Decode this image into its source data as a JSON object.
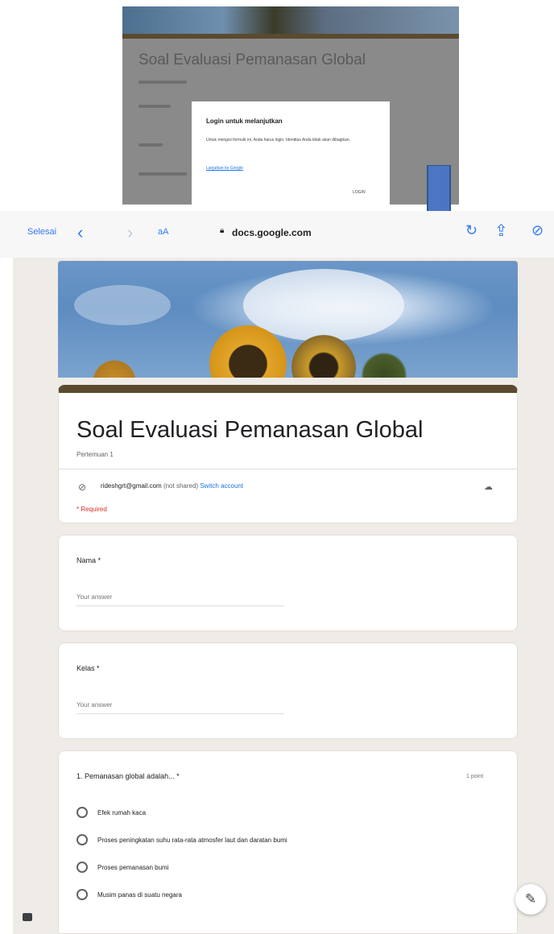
{
  "inset_screenshot": {
    "form_title": "Soal Evaluasi Pemanasan Global",
    "dialog": {
      "title": "Login untuk melanjutkan",
      "body": "Untuk mengisi formulir ini, Anda harus login. Identitas Anda tidak akan dibagikan.",
      "link": "Lanjutkan ke Google",
      "button": "LOGIN"
    }
  },
  "browser": {
    "done_label": "Selesai",
    "back_icon": "chevron-left-icon",
    "forward_icon": "chevron-right-icon",
    "text_size_label": "aA",
    "url": "docs.google.com",
    "lock_icon": "lock-icon",
    "reload_icon": "reload-icon",
    "share_icon": "share-icon",
    "compass_icon": "compass-icon",
    "accent_color": "#3478f6"
  },
  "form": {
    "title": "Soal Evaluasi Pemanasan Global",
    "subtitle": "Pertemuan 1",
    "account_email": "rideshgrt@gmail.com",
    "not_shared": "(not shared)",
    "switch_account": "Switch account",
    "required_note": "* Required",
    "theme_color": "#5b4a2f",
    "background_color": "#efebe6"
  },
  "questions": [
    {
      "label": "Nama *",
      "placeholder": "Your answer"
    },
    {
      "label": "Kelas *",
      "placeholder": "Your answer"
    }
  ],
  "multiple_choice": {
    "question": "1. Pemanasan global adalah... *",
    "points": "1 point",
    "options": [
      "Efek rumah kaca",
      "Proses peningkatan suhu rata-rata atmosfer laut dan daratan bumi",
      "Proses pemanasan bumi",
      "Musim panas di suatu negara"
    ]
  },
  "fab_icon": "pencil-icon",
  "feedback_icon": "feedback-icon"
}
